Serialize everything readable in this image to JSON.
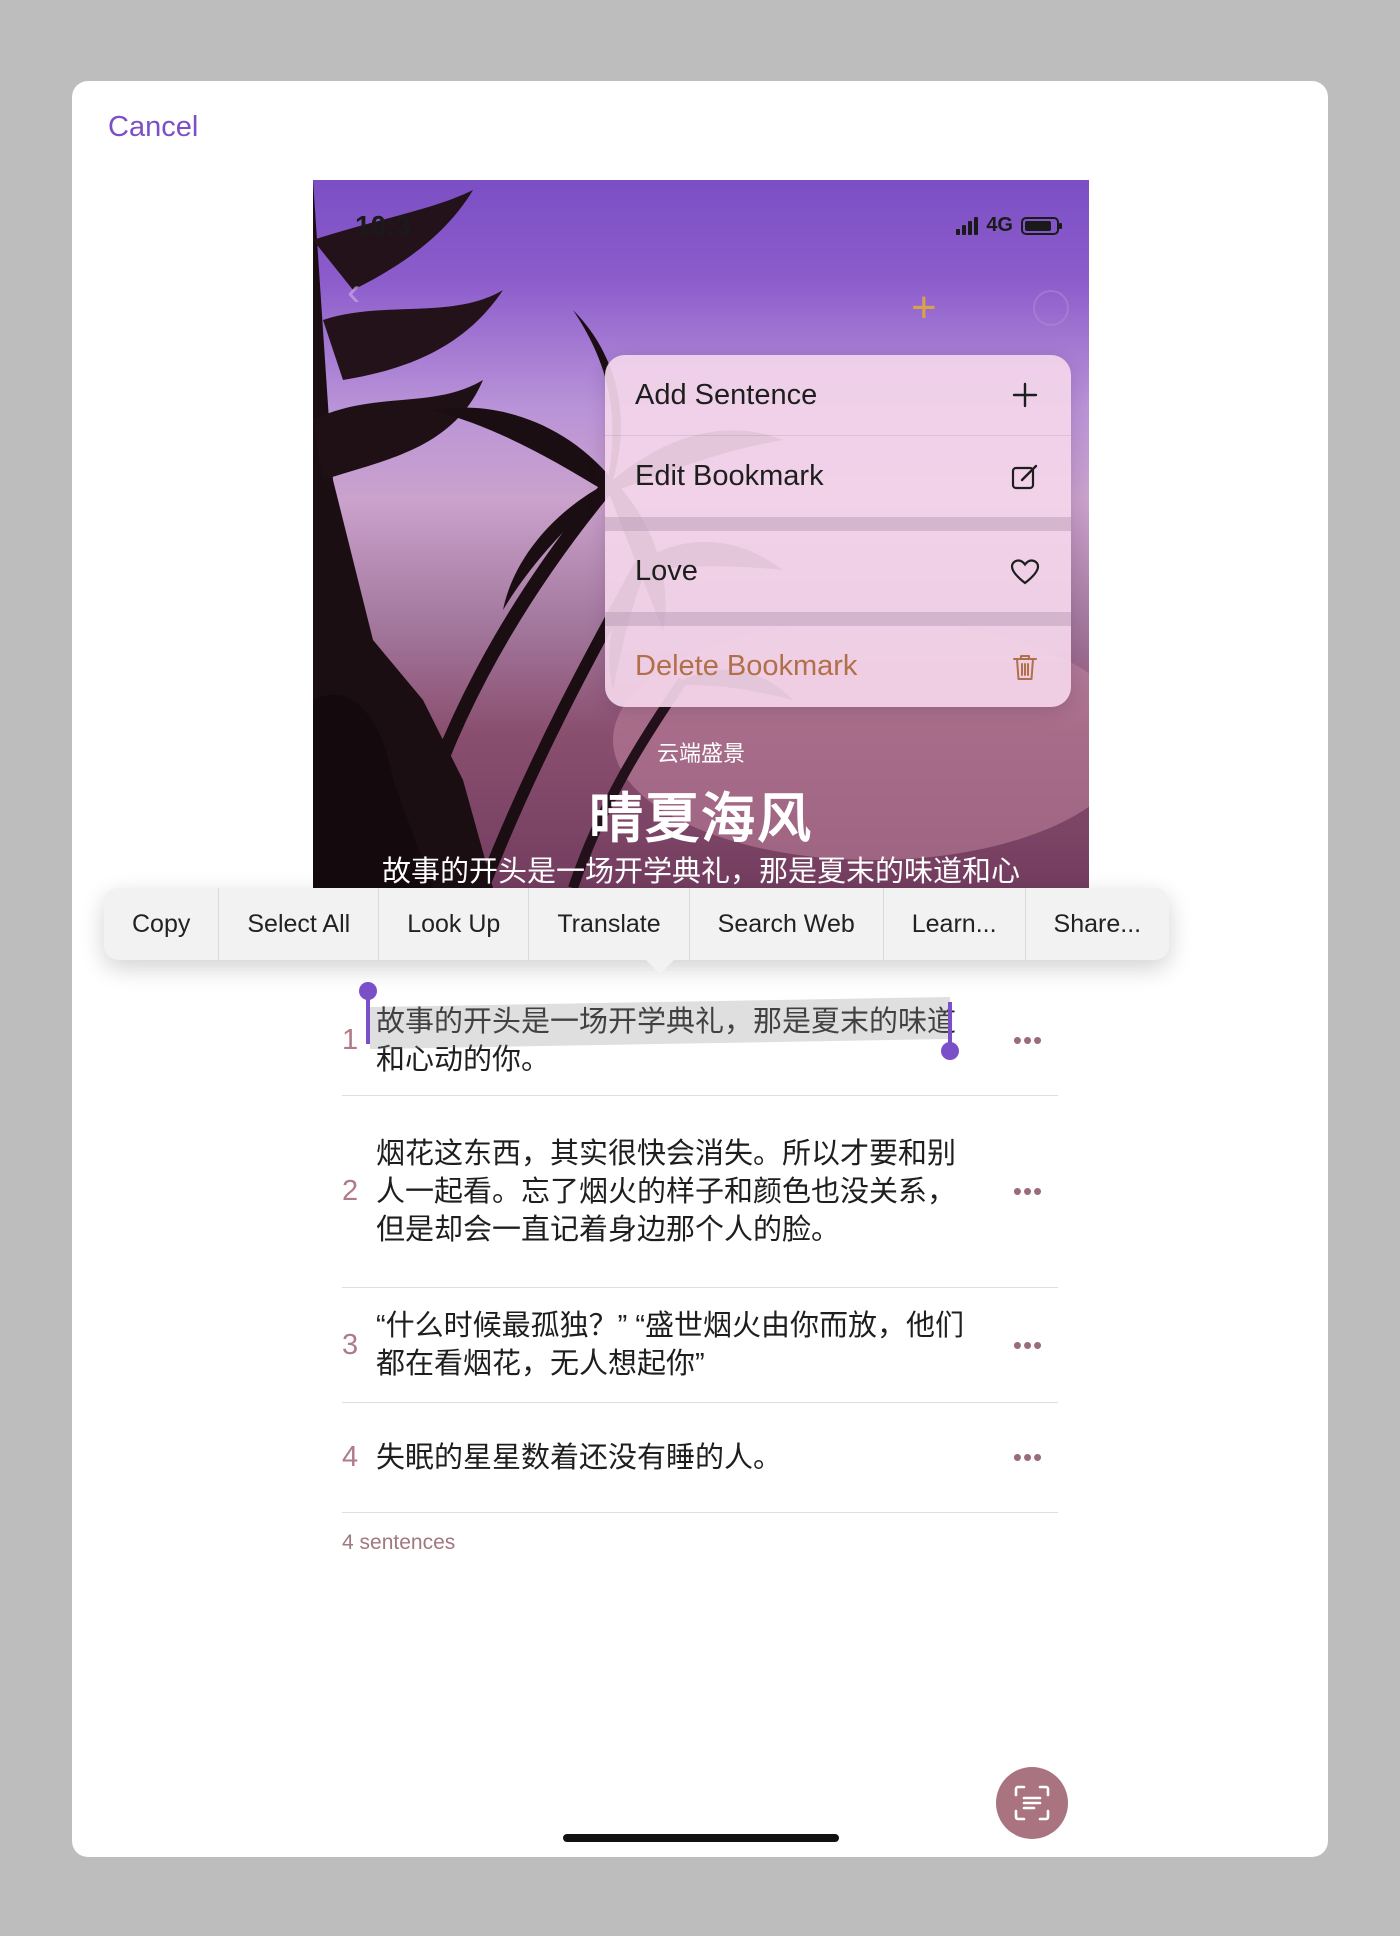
{
  "cancel_label": "Cancel",
  "screenshot": {
    "status_time": "10:3",
    "network": "4G",
    "subtitle": "云端盛景",
    "title": "晴夏海风",
    "text_line": "故事的开头是一场开学典礼，那是夏末的味道和心"
  },
  "context_menu": {
    "items": [
      {
        "label": "Add Sentence",
        "icon": "plus-icon"
      },
      {
        "label": "Edit Bookmark",
        "icon": "edit-icon"
      },
      {
        "label": "Love",
        "icon": "heart-icon"
      },
      {
        "label": "Delete Bookmark",
        "icon": "trash-icon"
      }
    ]
  },
  "edit_menu": [
    "Copy",
    "Select All",
    "Look Up",
    "Translate",
    "Search Web",
    "Learn...",
    "Share..."
  ],
  "sentences": [
    {
      "num": "1",
      "text": "故事的开头是一场开学典礼，那是夏末的味道和心动的你。"
    },
    {
      "num": "2",
      "text": "烟花这东西，其实很快会消失。所以才要和别人一起看。忘了烟火的样子和颜色也没关系，但是却会一直记着身边那个人的脸。"
    },
    {
      "num": "3",
      "text": "“什么时候最孤独？” “盛世烟火由你而放，他们都在看烟花，无人想起你”"
    },
    {
      "num": "4",
      "text": "失眠的星星数着还没有睡的人。"
    }
  ],
  "more_label": "•••",
  "sentence_count": "4 sentences",
  "colors": {
    "accent": "#7d4fc4",
    "number": "#b07a86",
    "scan_button": "#a97480"
  }
}
